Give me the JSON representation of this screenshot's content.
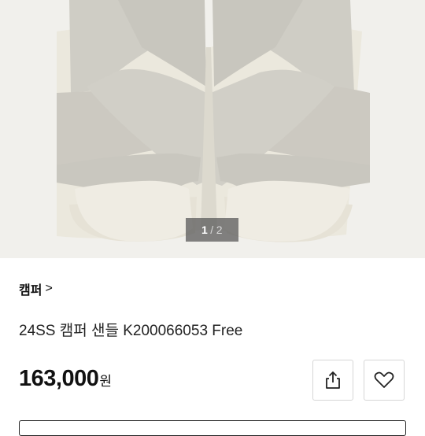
{
  "gallery": {
    "current_index": "1",
    "separator": "/",
    "total": "2"
  },
  "shop": {
    "name": "캠퍼",
    "chevron": ">"
  },
  "product": {
    "title": "24SS 캠퍼 샌들 K200066053 Free",
    "price": "163,000",
    "currency_unit": "원"
  },
  "icons": {
    "share": "share-icon",
    "wishlist": "heart-icon"
  },
  "colors": {
    "hero_background": "#f1f0ec",
    "strap": "#cdcbc3",
    "insole": "#ebe8dd"
  }
}
